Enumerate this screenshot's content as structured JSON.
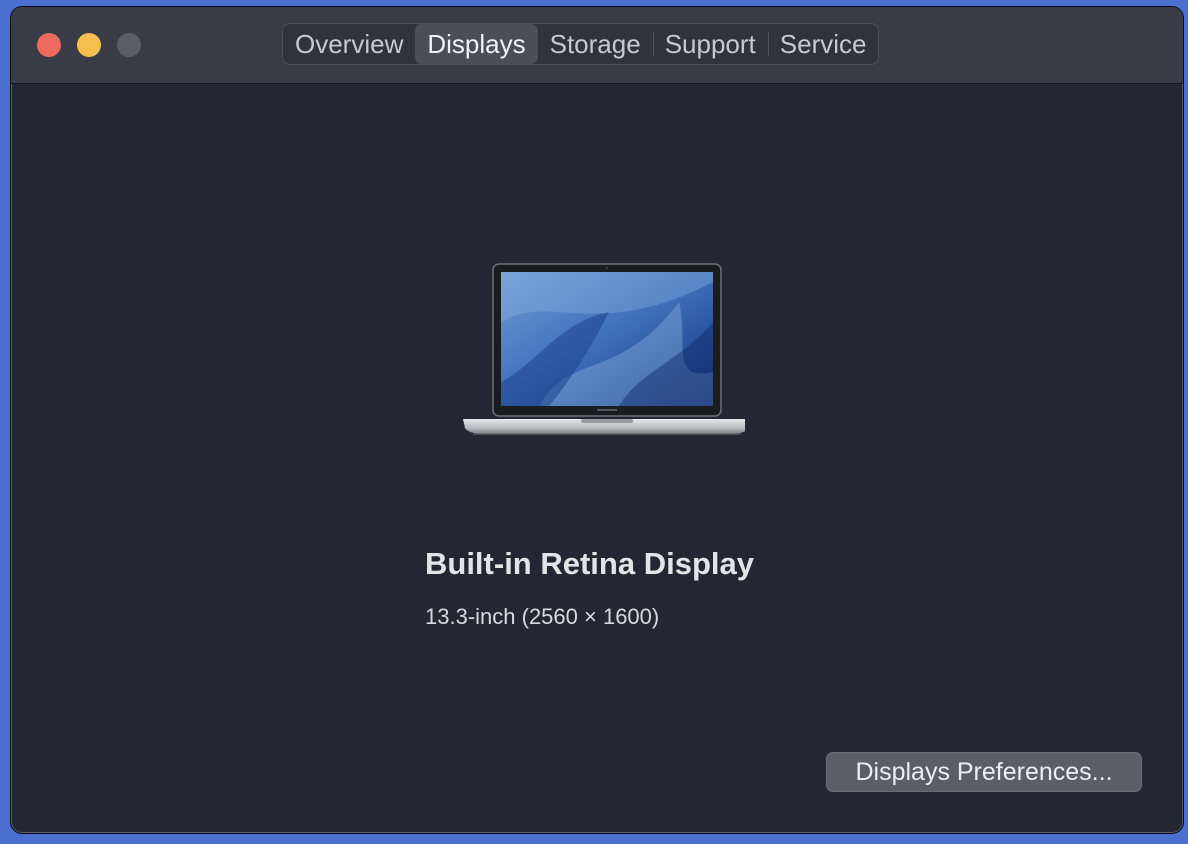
{
  "window": {
    "controls": [
      "close",
      "minimize",
      "zoom"
    ]
  },
  "tabs": [
    {
      "label": "Overview",
      "active": false
    },
    {
      "label": "Displays",
      "active": true
    },
    {
      "label": "Storage",
      "active": false
    },
    {
      "label": "Support",
      "active": false
    },
    {
      "label": "Service",
      "active": false
    }
  ],
  "display": {
    "name": "Built-in Retina Display",
    "spec": "13.3-inch (2560 × 1600)",
    "image_icon": "macbook-pro-image"
  },
  "buttons": {
    "preferences_label": "Displays Preferences..."
  },
  "colors": {
    "close": "#ed6a5e",
    "minimize": "#f4bf4f",
    "zoom": "#5b5e67",
    "window_bg": "#232733",
    "titlebar_bg": "#393c46"
  }
}
